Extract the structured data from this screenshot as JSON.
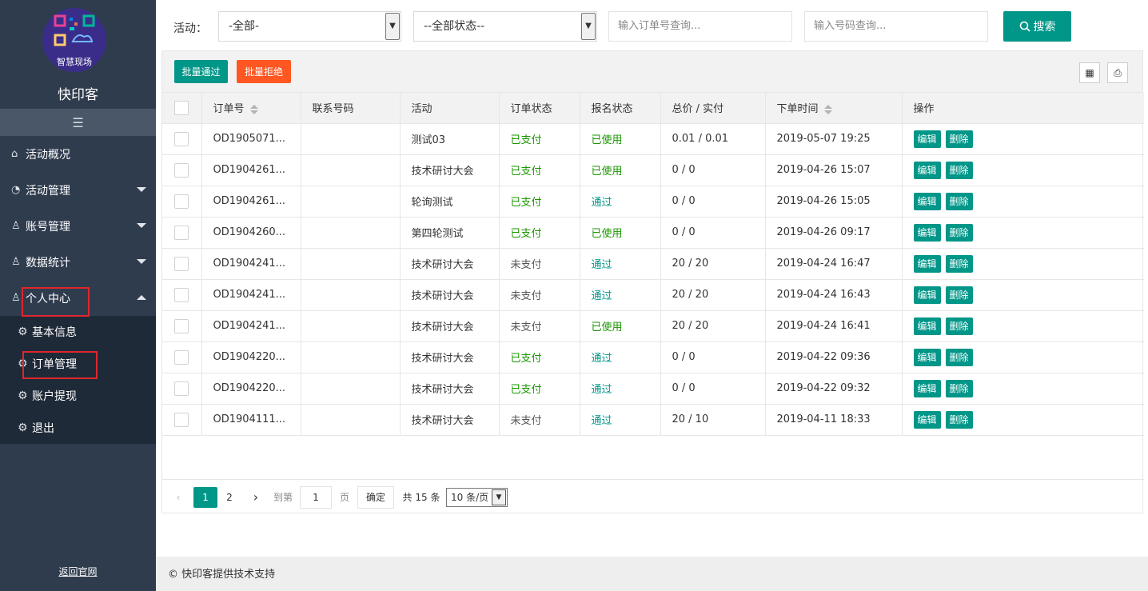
{
  "sidebar": {
    "logo_text": "智慧现场",
    "brand": "快印客",
    "collapse_icon": "☰",
    "nav": [
      {
        "label": "活动概况",
        "icon": "home-icon",
        "has_caret": false
      },
      {
        "label": "活动管理",
        "icon": "dashboard-icon",
        "has_caret": true
      },
      {
        "label": "账号管理",
        "icon": "users-icon",
        "has_caret": true
      },
      {
        "label": "数据统计",
        "icon": "users-icon",
        "has_caret": true
      },
      {
        "label": "个人中心",
        "icon": "user-icon",
        "has_caret": true,
        "expanded": true
      }
    ],
    "sub_nav": [
      {
        "label": "基本信息"
      },
      {
        "label": "订单管理"
      },
      {
        "label": "账户提现"
      },
      {
        "label": "退出"
      }
    ],
    "back_link": "返回官网"
  },
  "filters": {
    "activity_label": "活动：",
    "activity_select": "-全部-",
    "status_select": "--全部状态--",
    "order_placeholder": "输入订单号查询...",
    "phone_placeholder": "输入号码查询...",
    "search_label": "搜索"
  },
  "toolbar": {
    "batch_pass": "批量通过",
    "batch_reject": "批量拒绝"
  },
  "table": {
    "headers": {
      "order_no": "订单号",
      "phone": "联系号码",
      "activity": "活动",
      "order_status": "订单状态",
      "signup_status": "报名状态",
      "price": "总价 / 实付",
      "time": "下单时间",
      "ops": "操作"
    },
    "edit_label": "编辑",
    "delete_label": "删除",
    "rows": [
      {
        "order_no": "OD1905071...",
        "phone": "",
        "activity": "测试03",
        "order_status": "已支付",
        "signup_status": "已使用",
        "price": "0.01 / 0.01",
        "time": "2019-05-07 19:25"
      },
      {
        "order_no": "OD1904261...",
        "phone": "",
        "activity": "技术研讨大会",
        "order_status": "已支付",
        "signup_status": "已使用",
        "price": "0 / 0",
        "time": "2019-04-26 15:07"
      },
      {
        "order_no": "OD1904261...",
        "phone": "",
        "activity": "轮询测试",
        "order_status": "已支付",
        "signup_status": "通过",
        "price": "0 / 0",
        "time": "2019-04-26 15:05"
      },
      {
        "order_no": "OD1904260...",
        "phone": "",
        "activity": "第四轮测试",
        "order_status": "已支付",
        "signup_status": "已使用",
        "price": "0 / 0",
        "time": "2019-04-26 09:17"
      },
      {
        "order_no": "OD1904241...",
        "phone": "",
        "activity": "技术研讨大会",
        "order_status": "未支付",
        "signup_status": "通过",
        "price": "20 / 20",
        "time": "2019-04-24 16:47"
      },
      {
        "order_no": "OD1904241...",
        "phone": "",
        "activity": "技术研讨大会",
        "order_status": "未支付",
        "signup_status": "通过",
        "price": "20 / 20",
        "time": "2019-04-24 16:43"
      },
      {
        "order_no": "OD1904241...",
        "phone": "",
        "activity": "技术研讨大会",
        "order_status": "未支付",
        "signup_status": "已使用",
        "price": "20 / 20",
        "time": "2019-04-24 16:41"
      },
      {
        "order_no": "OD1904220...",
        "phone": "",
        "activity": "技术研讨大会",
        "order_status": "已支付",
        "signup_status": "通过",
        "price": "0 / 0",
        "time": "2019-04-22 09:36"
      },
      {
        "order_no": "OD1904220...",
        "phone": "",
        "activity": "技术研讨大会",
        "order_status": "已支付",
        "signup_status": "通过",
        "price": "0 / 0",
        "time": "2019-04-22 09:32"
      },
      {
        "order_no": "OD1904111...",
        "phone": "",
        "activity": "技术研讨大会",
        "order_status": "未支付",
        "signup_status": "通过",
        "price": "20 / 10",
        "time": "2019-04-11 18:33"
      }
    ]
  },
  "pager": {
    "prev": "‹",
    "page1": "1",
    "page2": "2",
    "next": "›",
    "goto_label": "到第",
    "goto_value": "1",
    "page_unit": "页",
    "confirm": "确定",
    "total": "共 15 条",
    "per_page": "10 条/页"
  },
  "footer": {
    "text": "© 快印客提供技术支持"
  },
  "colors": {
    "primary": "#009688",
    "danger": "#ff5722",
    "sidebar_bg": "#2f3c4e",
    "highlight": "#e0262c"
  }
}
